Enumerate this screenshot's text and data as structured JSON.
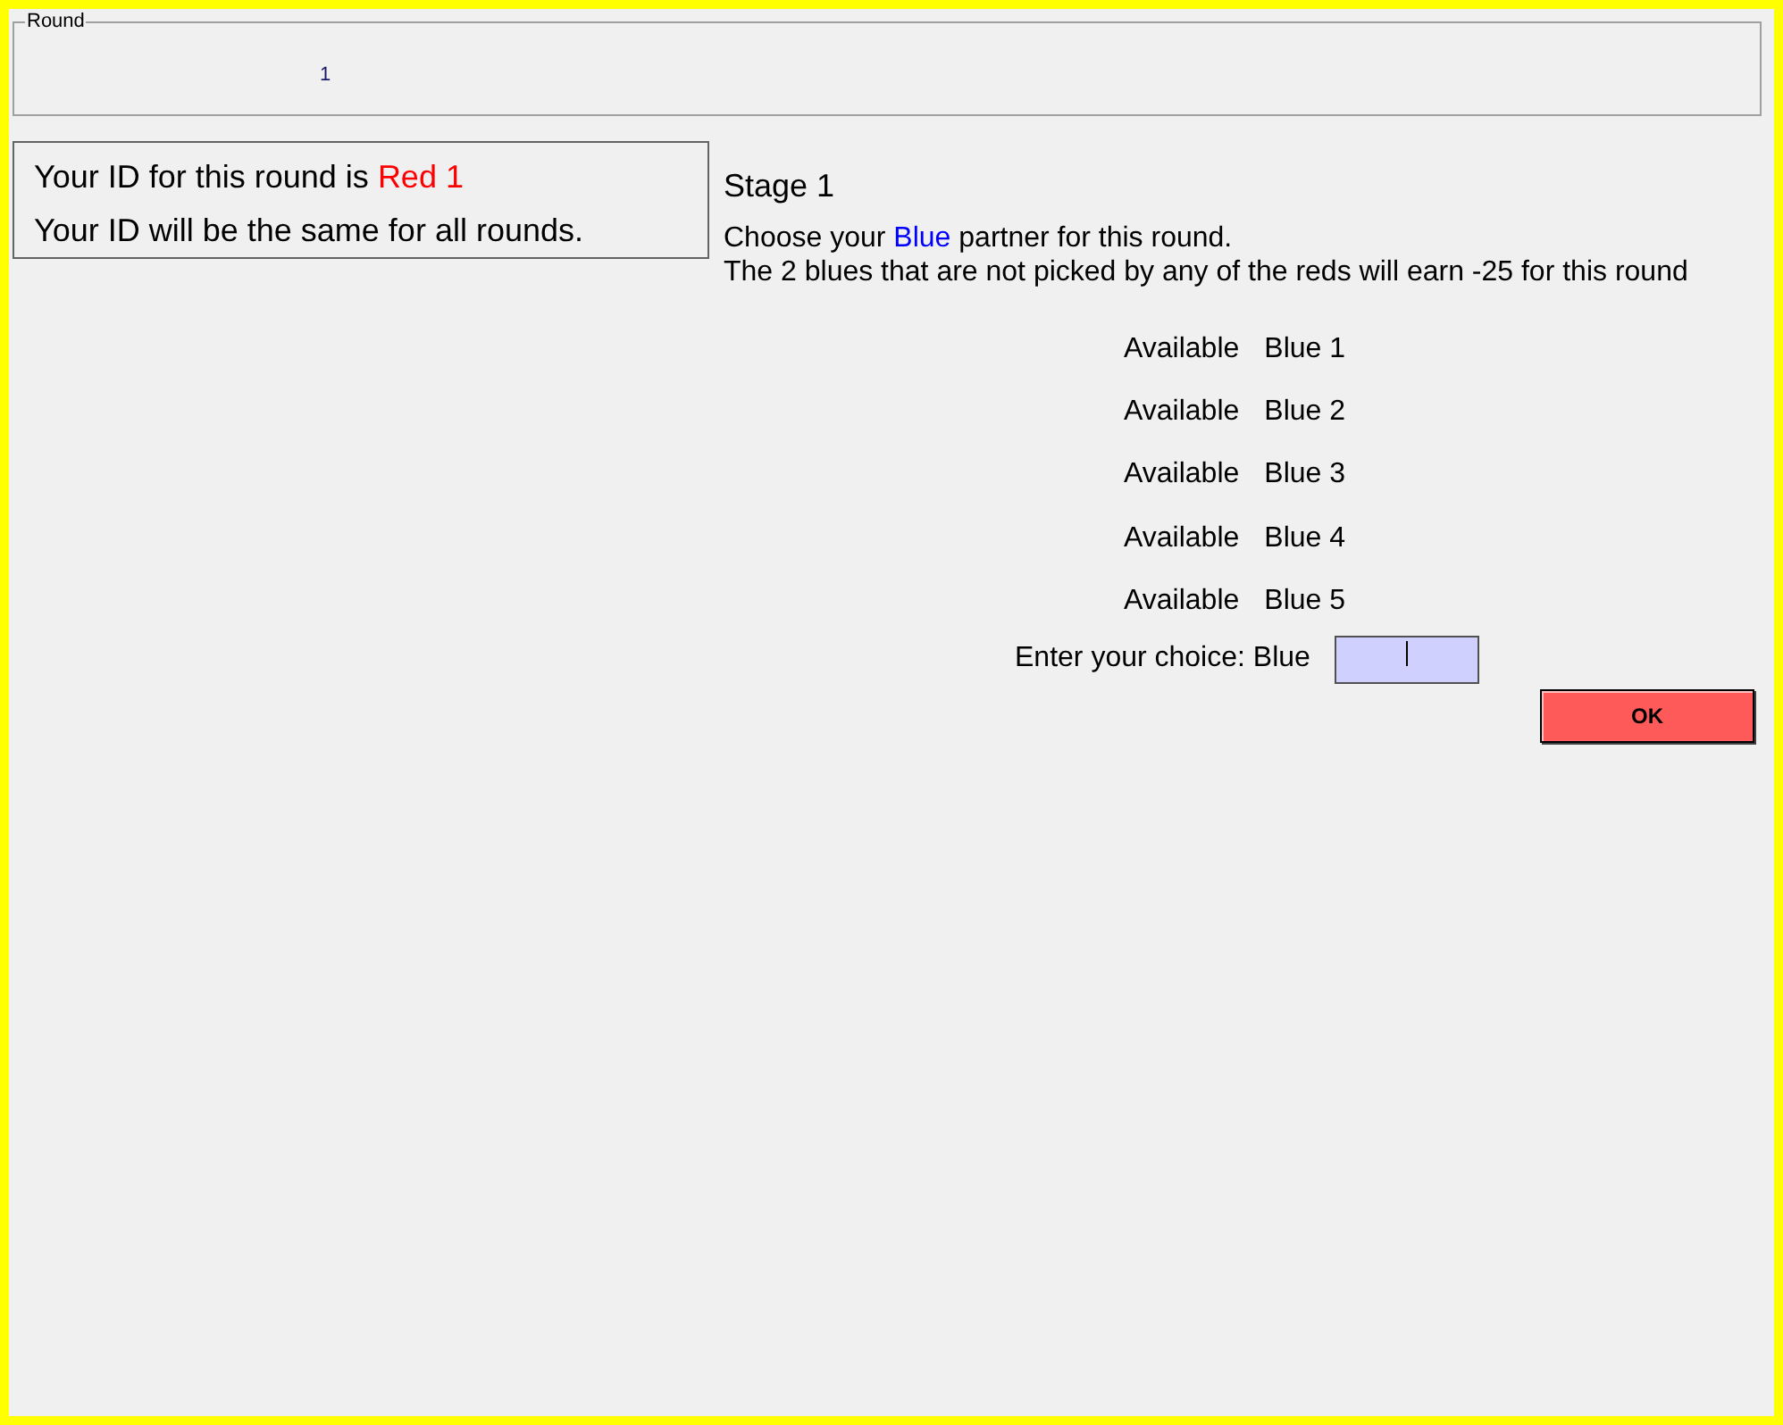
{
  "round": {
    "legend": "Round",
    "value": "1"
  },
  "id_box": {
    "lines": [
      {
        "parts": [
          {
            "text": "Your ID for this round is ",
            "color": "#000000"
          },
          {
            "text": "Red 1",
            "color": "#ff0000"
          }
        ]
      },
      {
        "parts": [
          {
            "text": "Your ID will be the same for all rounds.",
            "color": "#000000"
          }
        ]
      }
    ]
  },
  "stage": {
    "title": "Stage 1",
    "instructions": [
      {
        "parts": [
          {
            "text": " Choose your ",
            "color": "#000000"
          },
          {
            "text": "Blue",
            "color": "#0000ff"
          },
          {
            "text": " partner for this round.",
            "color": "#000000"
          }
        ]
      },
      {
        "parts": [
          {
            "text": "The 2 blues that are not picked by any of the reds will earn -25 for this round",
            "color": "#000000"
          }
        ]
      }
    ]
  },
  "partners": [
    {
      "status": "Available",
      "name": "Blue 1"
    },
    {
      "status": "Available",
      "name": "Blue 2"
    },
    {
      "status": "Available",
      "name": "Blue 3"
    },
    {
      "status": "Available",
      "name": "Blue 4"
    },
    {
      "status": "Available",
      "name": "Blue 5"
    }
  ],
  "choice": {
    "label": "Enter your choice: Blue",
    "focused": true
  },
  "buttons": [
    {
      "label": "OK"
    }
  ]
}
